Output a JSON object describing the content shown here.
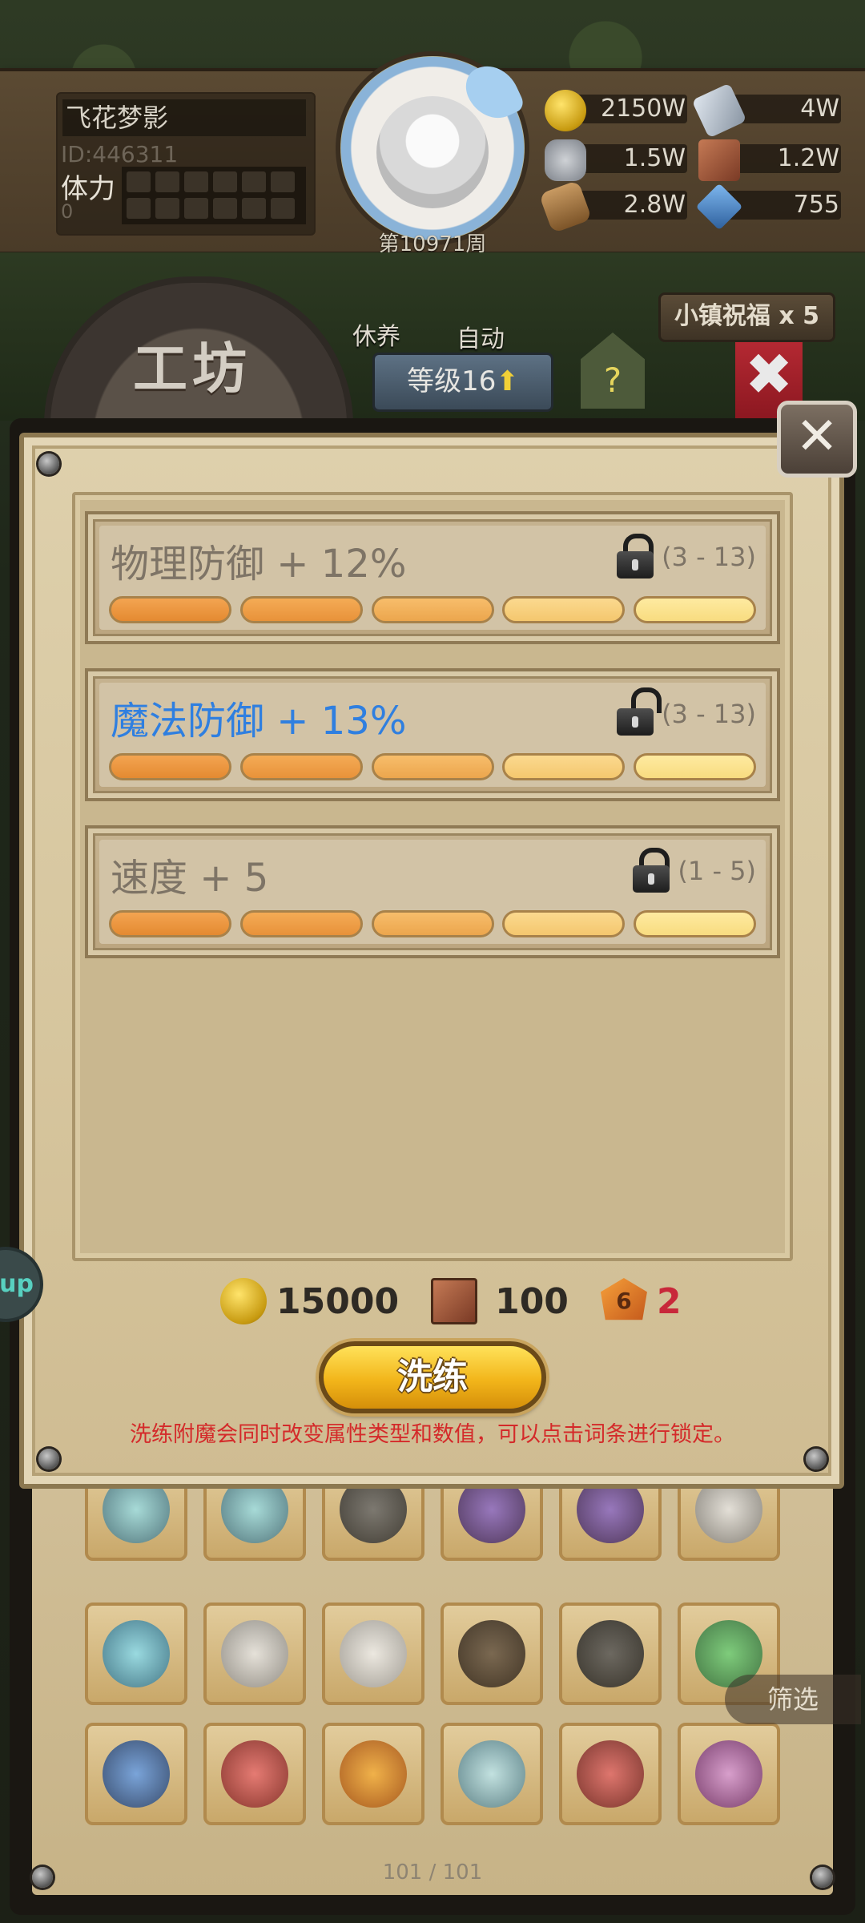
{
  "player": {
    "name": "飞花梦影",
    "id": "ID:446311",
    "stamina_label": "体力",
    "stamina_value": "0"
  },
  "week": "第10971周",
  "resources": [
    {
      "icon": "gold-coin-icon",
      "value": "2150W"
    },
    {
      "icon": "iron-ingot-icon",
      "value": "4W"
    },
    {
      "icon": "stone-icon",
      "value": "1.5W"
    },
    {
      "icon": "leather-icon",
      "value": "1.2W"
    },
    {
      "icon": "wood-log-icon",
      "value": "2.8W"
    },
    {
      "icon": "crystal-icon",
      "value": "755"
    }
  ],
  "nav": {
    "rest": "休养",
    "auto": "自动",
    "workshop_title": "工坊",
    "level": "等级16",
    "help": "?",
    "blessing": "小镇祝福 x 5"
  },
  "attributes": [
    {
      "name": "物理防御 + 12%",
      "range": "(3 - 13)",
      "locked": true,
      "highlight": false
    },
    {
      "name": "魔法防御 + 13%",
      "range": "(3 - 13)",
      "locked": false,
      "highlight": true
    },
    {
      "name": "速度 + 5",
      "range": "(1 - 5)",
      "locked": true,
      "highlight": false
    }
  ],
  "cost": {
    "gold": "15000",
    "scroll": "100",
    "gem_badge": "6",
    "gem": "2"
  },
  "refine_button": "洗练",
  "hint": "洗练附魔会同时改变属性类型和数值，可以点击词条进行锁定。",
  "filter_button": "筛选",
  "page": "101 / 101",
  "side_bubble": "up",
  "colors": {
    "highlight_blue": "#2f7fe0",
    "hint_red": "#d42a2a",
    "gem_count_red": "#c8283a"
  }
}
